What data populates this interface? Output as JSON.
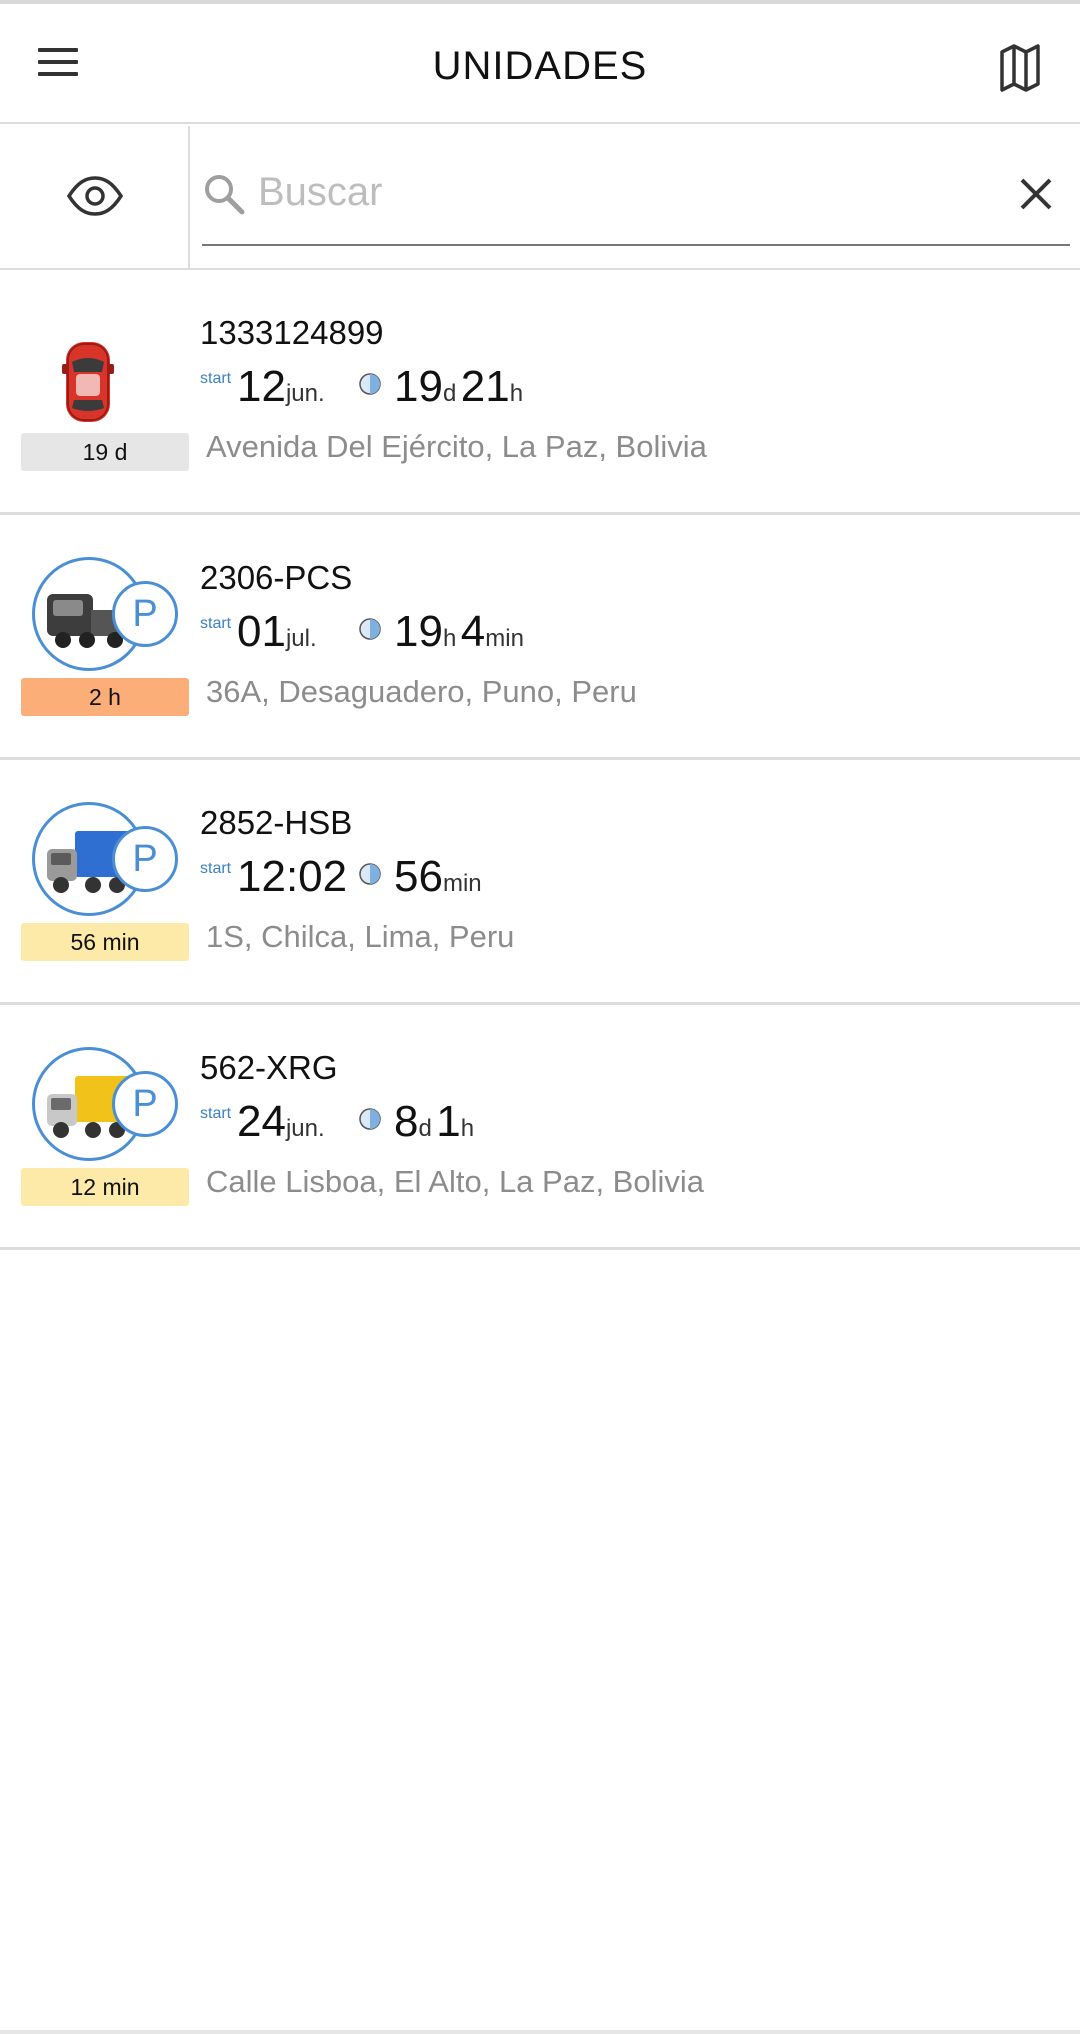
{
  "header": {
    "title": "UNIDADES",
    "menu_icon": "hamburger-menu-icon",
    "map_icon": "map-icon"
  },
  "search": {
    "placeholder": "Buscar",
    "value": "",
    "visibility_icon": "eye-icon",
    "search_icon": "search-icon",
    "clear_icon": "close-icon"
  },
  "units": [
    {
      "name": "1333124899",
      "icon": "red-car-icon",
      "parked": false,
      "age_label": "19 d",
      "age_color": "#e6e6e6",
      "start_label": "start",
      "start_big": "12",
      "start_small": "jun.",
      "dur_1_big": "19",
      "dur_1_small": "d",
      "dur_2_big": "21",
      "dur_2_small": "h",
      "address": "Avenida Del Ejército, La Paz, Bolivia"
    },
    {
      "name": "2306-PCS",
      "icon": "dark-truck-icon",
      "parked": true,
      "parked_icon": "parking-icon",
      "parked_letter": "P",
      "age_label": "2 h",
      "age_color": "#fbae77",
      "start_label": "start",
      "start_big": "01",
      "start_small": "jul.",
      "dur_1_big": "19",
      "dur_1_small": "h",
      "dur_2_big": "4",
      "dur_2_small": "min",
      "address": "36A, Desaguadero, Puno, Peru"
    },
    {
      "name": "2852-HSB",
      "icon": "blue-truck-icon",
      "parked": true,
      "parked_icon": "parking-icon",
      "parked_letter": "P",
      "age_label": "56 min",
      "age_color": "#fdeaa8",
      "start_label": "start",
      "start_big": "12:02",
      "start_small": "",
      "dur_1_big": "56",
      "dur_1_small": "min",
      "dur_2_big": "",
      "dur_2_small": "",
      "address": "1S, Chilca, Lima, Peru"
    },
    {
      "name": "562-XRG",
      "icon": "yellow-truck-icon",
      "parked": true,
      "parked_icon": "parking-icon",
      "parked_letter": "P",
      "age_label": "12 min",
      "age_color": "#fdeaa8",
      "start_label": "start",
      "start_big": "24",
      "start_small": "jun.",
      "dur_1_big": "8",
      "dur_1_small": "d",
      "dur_2_big": "1",
      "dur_2_small": "h",
      "address": "Calle Lisboa, El Alto, La Paz, Bolivia"
    }
  ]
}
